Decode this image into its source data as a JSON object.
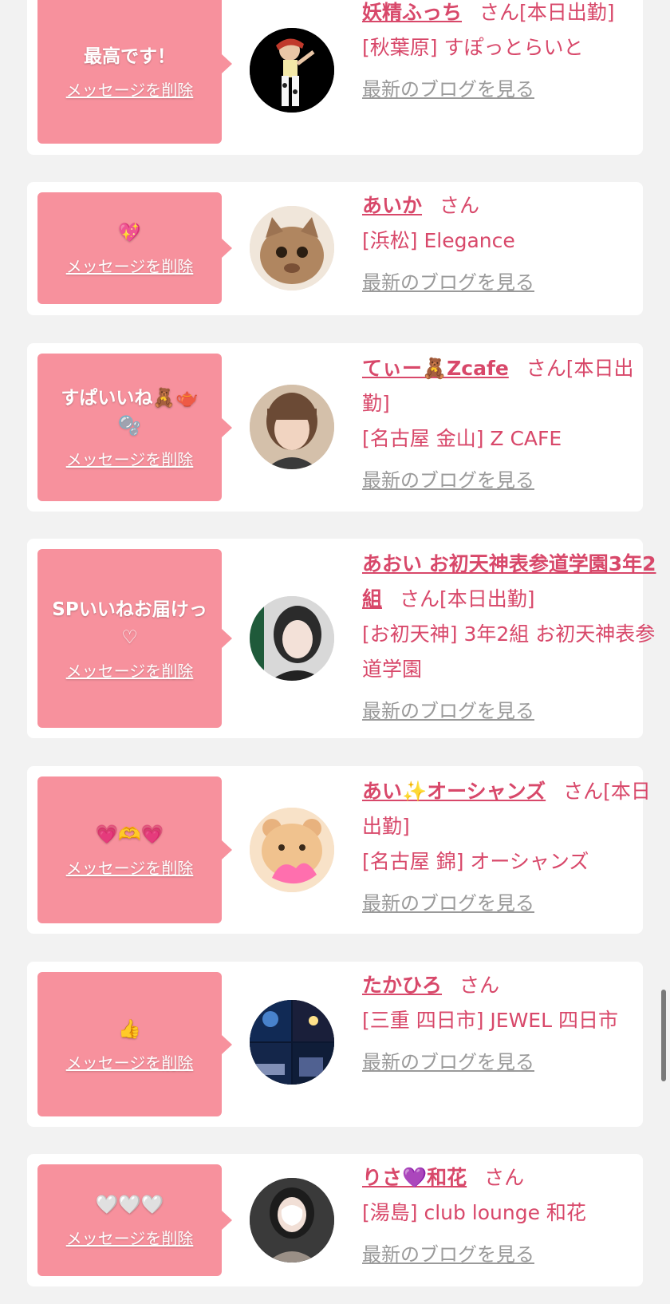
{
  "delete_label": "メッセージを削除",
  "san_label": "さん",
  "blog_label": "最新のブログを見る",
  "entries": [
    {
      "message": "最高です！",
      "name": "妖精ふっち",
      "suffix": "[本日出勤]",
      "shop": "[秋葉原] すぽっとらいと",
      "avatar_icon": "cowgirl-figure-icon"
    },
    {
      "message": "💖",
      "name": "あいか",
      "suffix": "",
      "shop": "[浜松] Elegance",
      "avatar_icon": "cat-face-icon"
    },
    {
      "message": "すぱいいね🧸🫖🫧",
      "name": "てぃー🧸Zcafe",
      "suffix": "[本日出勤]",
      "shop": "[名古屋 金山] Z CAFE",
      "avatar_icon": "portrait-icon"
    },
    {
      "message": "SPいいねお届けっ♡",
      "name": "あおい お初天神表参道学園3年2組",
      "suffix": "[本日出勤]",
      "shop": "[お初天神] 3年2組 お初天神表参道学園",
      "avatar_icon": "portrait-icon"
    },
    {
      "message": "💗🫶💗",
      "name": "あい✨オーシャンズ",
      "suffix": "[本日出勤]",
      "shop": "[名古屋 錦] オーシャンズ",
      "avatar_icon": "bear-icon"
    },
    {
      "message": "👍",
      "name": "たかひろ",
      "suffix": "",
      "shop": "[三重 四日市] JEWEL 四日市",
      "avatar_icon": "night-city-icon"
    },
    {
      "message": "🤍🤍🤍",
      "name": "りさ💜和花",
      "suffix": "",
      "shop": "[湯島] club lounge 和花",
      "avatar_icon": "portrait-icon"
    }
  ],
  "colors": {
    "accent": "#d8486a",
    "bubble": "#f7919d",
    "link_gray": "#9a9a9a",
    "background": "#f2f2f2"
  }
}
